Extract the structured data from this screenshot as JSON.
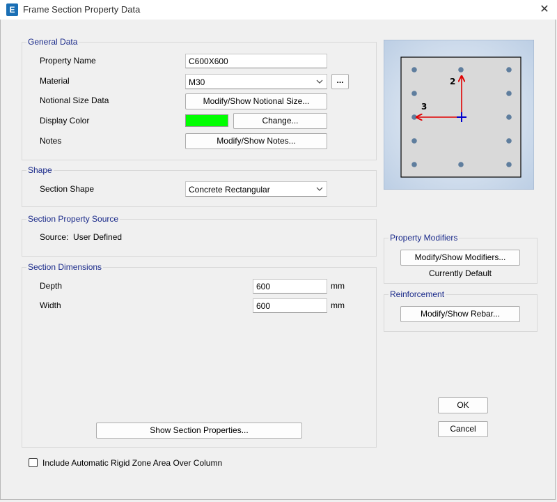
{
  "window": {
    "title": "Frame Section Property Data",
    "app_icon": "E",
    "close_glyph": "✕"
  },
  "general": {
    "title": "General Data",
    "property_name_label": "Property Name",
    "property_name_value": "C600X600",
    "material_label": "Material",
    "material_value": "M30",
    "ellipsis_label": "...",
    "notional_label": "Notional Size Data",
    "notional_button": "Modify/Show Notional Size...",
    "display_color_label": "Display Color",
    "display_color": "#00ff00",
    "change_button": "Change...",
    "notes_label": "Notes",
    "notes_button": "Modify/Show Notes..."
  },
  "shape": {
    "title": "Shape",
    "section_shape_label": "Section Shape",
    "section_shape_value": "Concrete Rectangular"
  },
  "source": {
    "title": "Section Property Source",
    "text": "Source:  User Defined"
  },
  "dimensions": {
    "title": "Section Dimensions",
    "depth_label": "Depth",
    "depth_value": "600",
    "depth_unit": "mm",
    "width_label": "Width",
    "width_value": "600",
    "width_unit": "mm",
    "show_props_button": "Show Section Properties..."
  },
  "preview": {
    "axis_2_label": "2",
    "axis_3_label": "3"
  },
  "modifiers": {
    "title": "Property Modifiers",
    "button": "Modify/Show Modifiers...",
    "status": "Currently Default"
  },
  "reinforcement": {
    "title": "Reinforcement",
    "button": "Modify/Show Rebar..."
  },
  "actions": {
    "ok": "OK",
    "cancel": "Cancel"
  },
  "rigid_zone": {
    "label": "Include Automatic Rigid Zone Area Over Column",
    "checked": false
  }
}
